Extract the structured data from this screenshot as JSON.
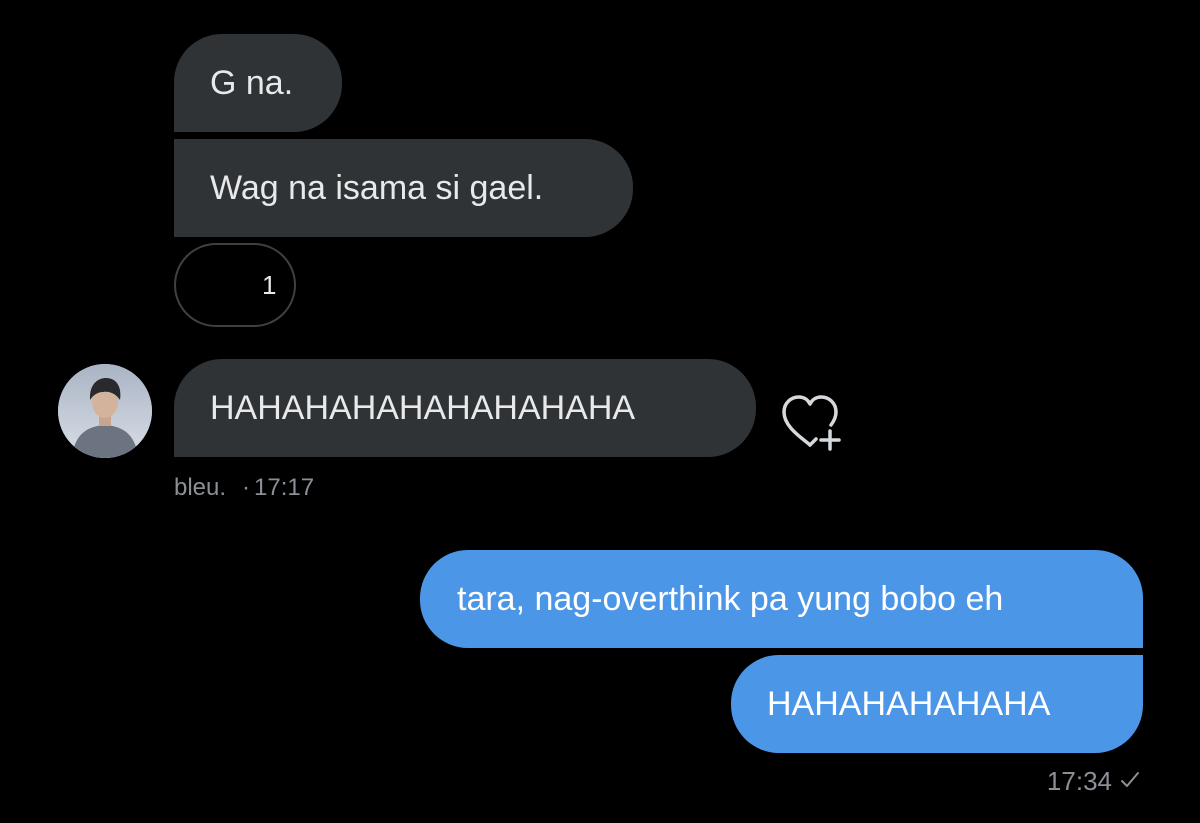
{
  "conversation": {
    "incoming": [
      {
        "text": "G na."
      },
      {
        "text": "Wag na isama si gael."
      },
      {
        "text": "HAHAHAHAHAHAHAHAHA"
      }
    ],
    "reaction": {
      "emoji": "😂",
      "emoji_name": "face-with-tears-of-joy",
      "count": "1"
    },
    "incoming_meta": {
      "sender": "bleu.",
      "separator": "·",
      "time": "17:17"
    },
    "outgoing": [
      {
        "text": "tara, nag-overthink pa yung bobo eh"
      },
      {
        "text": "HAHAHAHAHAHA"
      }
    ],
    "outgoing_meta": {
      "time": "17:34",
      "status_icon": "check-icon"
    }
  },
  "icons": {
    "react_button": "heart-plus-icon"
  },
  "colors": {
    "background": "#000000",
    "incoming_bubble": "#2f3336",
    "outgoing_bubble": "#4c96e8",
    "meta_text": "#8b9096"
  }
}
